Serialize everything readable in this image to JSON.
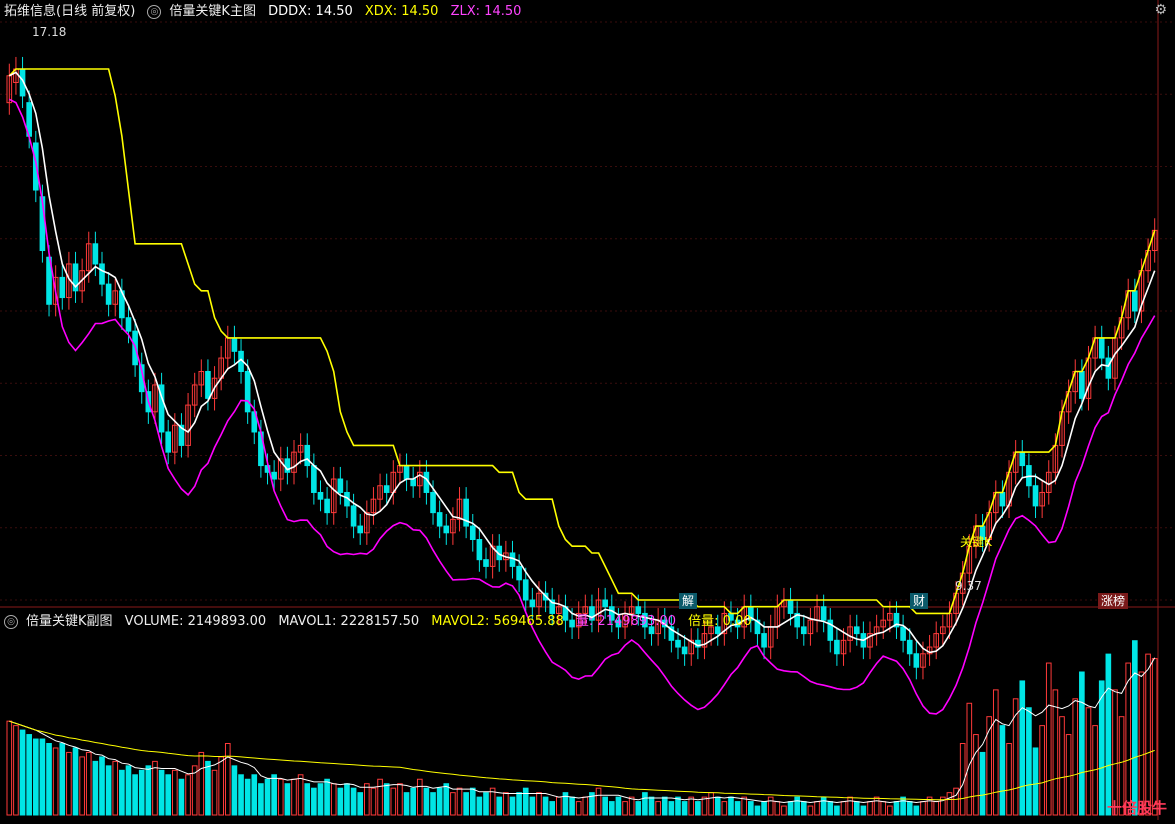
{
  "main_header": {
    "stock": "拓维信息(日线 前复权)",
    "indicator": "倍量关键K主图",
    "dddx": "DDDX: 14.50",
    "xdx": "XDX: 14.50",
    "zlx": "ZLX: 14.50"
  },
  "sub_header": {
    "indicator": "倍量关键K副图",
    "volume": "VOLUME: 2149893.00",
    "mavol1": "MAVOL1: 2228157.50",
    "mavol2": "MAVOL2: 569465.88",
    "liang": "量: 2149893.00",
    "beiliang": "倍量: 0.00"
  },
  "annotations": {
    "high": "17.18",
    "low": "9.37",
    "key_k": "关键K",
    "tag_jie": "解",
    "tag_cai": "财",
    "tag_zb": "涨榜"
  },
  "overlay_badge": "十倍股牛",
  "colors": {
    "up": "#ff3a3a",
    "down": "#00e5e5",
    "yellow": "#ffff00",
    "magenta": "#ff00ff",
    "white": "#ffffff"
  },
  "chart_data": {
    "type": "candlestick",
    "ylim": [
      9.0,
      17.6
    ],
    "close": [
      16.8,
      16.9,
      16.5,
      15.9,
      15.1,
      14.2,
      13.4,
      13.8,
      13.5,
      14.0,
      13.6,
      13.9,
      14.3,
      14.0,
      13.7,
      13.4,
      13.6,
      13.2,
      13.0,
      12.5,
      12.1,
      11.8,
      12.2,
      11.5,
      11.2,
      11.6,
      11.3,
      11.9,
      12.2,
      12.4,
      12.0,
      12.3,
      12.6,
      12.9,
      12.7,
      12.4,
      11.8,
      11.5,
      11.0,
      10.9,
      10.8,
      11.1,
      10.9,
      11.2,
      11.3,
      11.0,
      10.6,
      10.5,
      10.3,
      10.8,
      10.6,
      10.4,
      10.1,
      10.0,
      10.3,
      10.5,
      10.7,
      10.6,
      10.9,
      11.0,
      10.8,
      10.7,
      10.9,
      10.6,
      10.3,
      10.1,
      10.0,
      10.2,
      10.5,
      10.1,
      9.9,
      9.6,
      9.5,
      9.8,
      9.6,
      9.7,
      9.5,
      9.3,
      9.0,
      8.9,
      9.1,
      9.0,
      8.8,
      8.9,
      8.7,
      8.6,
      8.8,
      8.9,
      8.7,
      9.0,
      8.9,
      8.7,
      8.6,
      8.8,
      8.9,
      8.8,
      8.6,
      8.5,
      8.7,
      8.6,
      8.4,
      8.3,
      8.2,
      8.4,
      8.3,
      8.5,
      8.6,
      8.5,
      8.8,
      8.7,
      8.6,
      8.9,
      8.7,
      8.5,
      8.3,
      8.6,
      8.9,
      9.0,
      8.8,
      8.6,
      8.5,
      8.7,
      8.9,
      8.7,
      8.4,
      8.2,
      8.4,
      8.6,
      8.5,
      8.3,
      8.5,
      8.6,
      8.7,
      8.8,
      8.6,
      8.4,
      8.2,
      8.0,
      8.2,
      8.3,
      8.5,
      8.6,
      8.8,
      9.1,
      9.4,
      9.8,
      10.1,
      9.9,
      10.3,
      10.6,
      10.4,
      10.9,
      11.2,
      11.0,
      10.7,
      10.4,
      10.6,
      10.9,
      11.3,
      11.8,
      12.1,
      12.4,
      12.0,
      12.6,
      12.9,
      12.6,
      12.3,
      12.9,
      13.2,
      13.6,
      13.3,
      13.9,
      14.2,
      14.5
    ],
    "open": [
      16.4,
      16.7,
      16.9,
      16.4,
      15.8,
      15.0,
      14.1,
      13.4,
      13.8,
      13.5,
      14.0,
      13.6,
      13.9,
      14.3,
      14.0,
      13.7,
      13.4,
      13.6,
      13.2,
      13.0,
      12.5,
      12.1,
      11.8,
      12.2,
      11.5,
      11.2,
      11.6,
      11.3,
      11.9,
      12.2,
      12.4,
      12.0,
      12.3,
      12.6,
      12.9,
      12.7,
      12.4,
      11.8,
      11.5,
      11.0,
      10.9,
      10.8,
      11.1,
      10.9,
      11.2,
      11.3,
      11.0,
      10.6,
      10.5,
      10.3,
      10.8,
      10.6,
      10.4,
      10.1,
      10.0,
      10.3,
      10.5,
      10.7,
      10.6,
      10.9,
      11.0,
      10.8,
      10.7,
      10.9,
      10.6,
      10.3,
      10.1,
      10.0,
      10.2,
      10.5,
      10.1,
      9.9,
      9.6,
      9.5,
      9.8,
      9.6,
      9.7,
      9.5,
      9.3,
      9.0,
      8.9,
      9.1,
      9.0,
      8.8,
      8.9,
      8.7,
      8.6,
      8.8,
      8.9,
      8.7,
      9.0,
      8.9,
      8.7,
      8.6,
      8.8,
      8.9,
      8.8,
      8.6,
      8.5,
      8.7,
      8.6,
      8.4,
      8.3,
      8.2,
      8.4,
      8.3,
      8.5,
      8.6,
      8.5,
      8.8,
      8.7,
      8.6,
      8.9,
      8.7,
      8.5,
      8.3,
      8.6,
      8.9,
      9.0,
      8.8,
      8.6,
      8.5,
      8.7,
      8.9,
      8.7,
      8.4,
      8.2,
      8.4,
      8.6,
      8.5,
      8.3,
      8.5,
      8.6,
      8.7,
      8.8,
      8.6,
      8.4,
      8.2,
      8.0,
      8.2,
      8.3,
      8.5,
      8.6,
      8.8,
      9.1,
      9.4,
      9.8,
      10.1,
      9.9,
      10.3,
      10.6,
      10.4,
      10.9,
      11.2,
      11.0,
      10.7,
      10.4,
      10.6,
      10.9,
      11.3,
      11.8,
      12.1,
      12.4,
      12.0,
      12.6,
      12.9,
      12.6,
      12.3,
      12.9,
      13.2,
      13.6,
      13.3,
      13.9,
      14.2
    ],
    "volume": [
      2.1,
      2.0,
      1.9,
      1.8,
      1.7,
      1.7,
      1.6,
      1.5,
      1.6,
      1.4,
      1.5,
      1.3,
      1.4,
      1.2,
      1.3,
      1.1,
      1.2,
      1.0,
      1.1,
      0.9,
      1.0,
      1.1,
      1.2,
      1.0,
      0.9,
      1.0,
      0.8,
      0.9,
      1.1,
      1.4,
      1.2,
      1.0,
      1.3,
      1.6,
      1.1,
      0.9,
      0.8,
      0.9,
      0.7,
      0.8,
      0.9,
      0.8,
      0.7,
      0.8,
      0.9,
      0.7,
      0.6,
      0.7,
      0.8,
      0.7,
      0.6,
      0.7,
      0.6,
      0.5,
      0.7,
      0.6,
      0.8,
      0.7,
      0.6,
      0.7,
      0.5,
      0.6,
      0.8,
      0.6,
      0.5,
      0.6,
      0.7,
      0.5,
      0.6,
      0.5,
      0.6,
      0.4,
      0.5,
      0.6,
      0.4,
      0.5,
      0.4,
      0.5,
      0.6,
      0.4,
      0.5,
      0.4,
      0.3,
      0.4,
      0.5,
      0.4,
      0.3,
      0.4,
      0.5,
      0.6,
      0.4,
      0.3,
      0.4,
      0.3,
      0.4,
      0.3,
      0.5,
      0.4,
      0.3,
      0.4,
      0.3,
      0.4,
      0.3,
      0.4,
      0.3,
      0.4,
      0.5,
      0.4,
      0.3,
      0.4,
      0.3,
      0.4,
      0.3,
      0.2,
      0.3,
      0.4,
      0.3,
      0.2,
      0.3,
      0.4,
      0.3,
      0.2,
      0.3,
      0.4,
      0.3,
      0.2,
      0.3,
      0.4,
      0.3,
      0.2,
      0.3,
      0.4,
      0.3,
      0.2,
      0.3,
      0.4,
      0.3,
      0.2,
      0.3,
      0.4,
      0.3,
      0.4,
      0.5,
      0.6,
      1.6,
      2.5,
      1.8,
      1.4,
      2.2,
      2.8,
      2.0,
      1.6,
      2.6,
      3.0,
      2.4,
      1.5,
      2.0,
      3.4,
      2.8,
      2.2,
      1.8,
      2.6,
      3.2,
      2.4,
      2.0,
      3.0,
      3.6,
      2.8,
      2.2,
      3.4,
      3.9,
      3.2,
      3.6,
      3.5
    ],
    "mavol_lines": [
      "MAVOL1",
      "MAVOL2"
    ],
    "lines": [
      "DDDX",
      "XDX",
      "ZLX"
    ]
  }
}
